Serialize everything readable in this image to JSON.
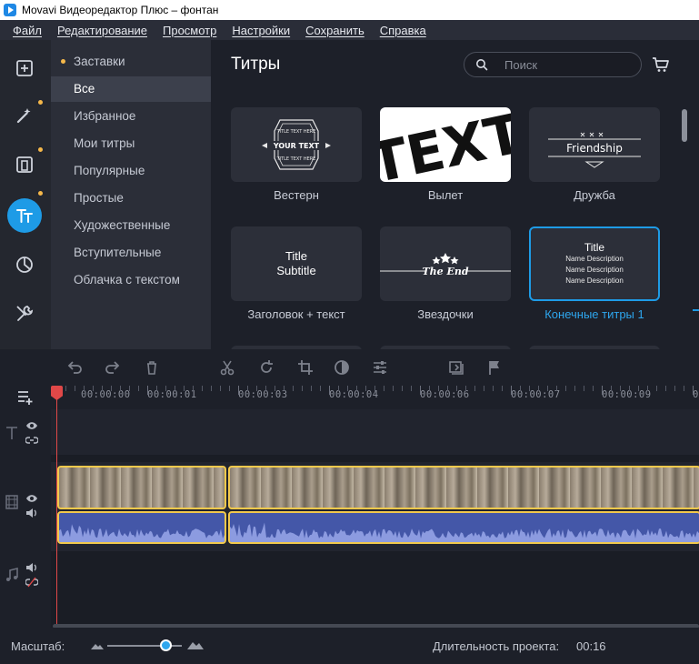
{
  "window": {
    "title": "Movavi Видеоредактор Плюс – фонтан"
  },
  "menu": [
    "Файл",
    "Редактирование",
    "Просмотр",
    "Настройки",
    "Сохранить",
    "Справка"
  ],
  "left_tools": [
    "import-icon",
    "magic-wand-icon",
    "filters-icon",
    "titles-icon",
    "transitions-icon",
    "tools-icon"
  ],
  "categories": {
    "header": "Заставки",
    "items": [
      "Все",
      "Избранное",
      "Мои титры",
      "Популярные",
      "Простые",
      "Художественные",
      "Вступительные",
      "Облачка с текстом"
    ],
    "selected": "Все"
  },
  "content": {
    "heading": "Титры",
    "search_placeholder": "Поиск"
  },
  "tiles": [
    {
      "label": "Вестерн",
      "art": {
        "line1": "TITLE TEXT HERE",
        "main": "YOUR TEXT",
        "line2": "TITLE TEXT HERE"
      }
    },
    {
      "label": "Вылет",
      "art": {
        "main": "TEXT"
      }
    },
    {
      "label": "Дружба",
      "art": {
        "main": "Friendship"
      }
    },
    {
      "label": "Заголовок + текст",
      "art": {
        "line1": "Title",
        "line2": "Subtitle"
      }
    },
    {
      "label": "Звездочки",
      "art": {
        "main": "The End"
      }
    },
    {
      "label": "Конечные титры 1",
      "art": {
        "title": "Title",
        "desc": "Name Description"
      },
      "selected": true
    }
  ],
  "timeline": {
    "timestamps": [
      "00:00:00",
      "00:00:01",
      "00:00:03",
      "00:00:04",
      "00:00:06",
      "00:00:07",
      "00:00:09"
    ]
  },
  "status": {
    "zoom_label": "Масштаб:",
    "zoom_level": 0.78,
    "duration_label": "Длительность проекта:",
    "duration_value": "00:16"
  },
  "colors": {
    "accent": "#1e9be6",
    "clip_border": "#f2c94c",
    "playhead": "#e04848",
    "audio": "#4457a8"
  }
}
